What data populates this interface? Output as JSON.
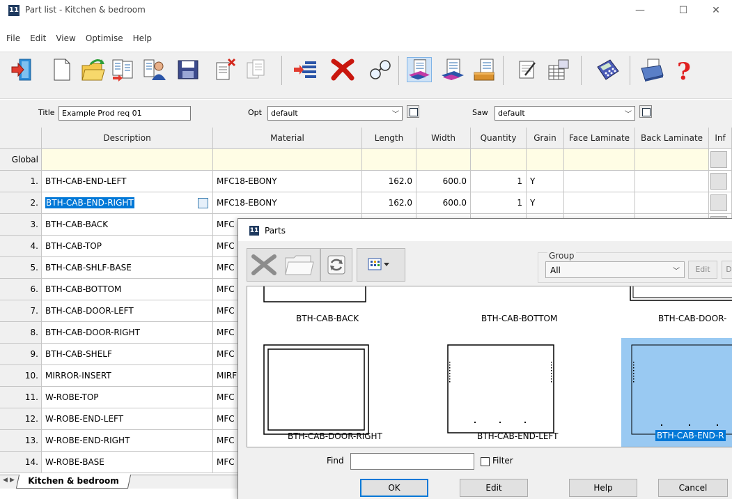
{
  "window": {
    "app_icon": "11",
    "title": "Part list - Kitchen & bedroom",
    "minimize_glyph": "—",
    "maximize_glyph": "☐",
    "close_glyph": "✕"
  },
  "menu": [
    "File",
    "Edit",
    "View",
    "Optimise",
    "Help"
  ],
  "toolbar_icons": [
    "exit-icon",
    "new-icon",
    "open-icon",
    "import-icon",
    "customer-icon",
    "save-icon",
    "delete-list-icon",
    "copy-list-icon",
    "insert-row-icon",
    "delete-row-icon",
    "search-icon",
    "parts-view-icon",
    "parts-edit-icon",
    "parts-stock-icon",
    "edit-icon",
    "grid-icon",
    "calculator-icon",
    "print-icon",
    "help-icon"
  ],
  "params": {
    "title_label": "Title",
    "title_value": "Example Prod req 01",
    "opt_label": "Opt",
    "opt_value": "default",
    "saw_label": "Saw",
    "saw_value": "default"
  },
  "grid": {
    "columns": [
      "Description",
      "Material",
      "Length",
      "Width",
      "Quantity",
      "Grain",
      "Face Laminate",
      "Back Laminate",
      "Inf"
    ],
    "global_label": "Global",
    "rows": [
      {
        "n": "1.",
        "desc": "BTH-CAB-END-LEFT",
        "mat": "MFC18-EBONY",
        "len": "162.0",
        "wid": "600.0",
        "qty": "1",
        "grain": "Y"
      },
      {
        "n": "2.",
        "desc": "BTH-CAB-END-RIGHT",
        "mat": "MFC18-EBONY",
        "len": "162.0",
        "wid": "600.0",
        "qty": "1",
        "grain": "Y"
      },
      {
        "n": "3.",
        "desc": "BTH-CAB-BACK",
        "mat": "MFC"
      },
      {
        "n": "4.",
        "desc": "BTH-CAB-TOP",
        "mat": "MFC"
      },
      {
        "n": "5.",
        "desc": "BTH-CAB-SHLF-BASE",
        "mat": "MFC"
      },
      {
        "n": "6.",
        "desc": "BTH-CAB-BOTTOM",
        "mat": "MFC"
      },
      {
        "n": "7.",
        "desc": "BTH-CAB-DOOR-LEFT",
        "mat": "MFC"
      },
      {
        "n": "8.",
        "desc": "BTH-CAB-DOOR-RIGHT",
        "mat": "MFC"
      },
      {
        "n": "9.",
        "desc": "BTH-CAB-SHELF",
        "mat": "MFC"
      },
      {
        "n": "10.",
        "desc": "MIRROR-INSERT",
        "mat": "MIRF"
      },
      {
        "n": "11.",
        "desc": "W-ROBE-TOP",
        "mat": "MFC"
      },
      {
        "n": "12.",
        "desc": "W-ROBE-END-LEFT",
        "mat": "MFC"
      },
      {
        "n": "13.",
        "desc": "W-ROBE-END-RIGHT",
        "mat": "MFC"
      },
      {
        "n": "14.",
        "desc": "W-ROBE-BASE",
        "mat": "MFC"
      }
    ]
  },
  "sheet_tab": "Kitchen & bedroom",
  "dialog": {
    "title": "Parts",
    "group_label": "Group",
    "group_value": "All",
    "edit_label": "Edit",
    "d_label": "D",
    "parts_row1": [
      "BTH-CAB-BACK",
      "BTH-CAB-BOTTOM",
      "BTH-CAB-DOOR-"
    ],
    "parts_row2": [
      "BTH-CAB-DOOR-RIGHT",
      "BTH-CAB-END-LEFT",
      "BTH-CAB-END-R"
    ],
    "find_label": "Find",
    "filter_label": "Filter",
    "ok": "OK",
    "edit": "Edit",
    "help": "Help",
    "cancel": "Cancel"
  },
  "colors": {
    "selection": "#0078d7",
    "global_row": "#fffde5",
    "thumb_selected": "#99c9f2"
  }
}
